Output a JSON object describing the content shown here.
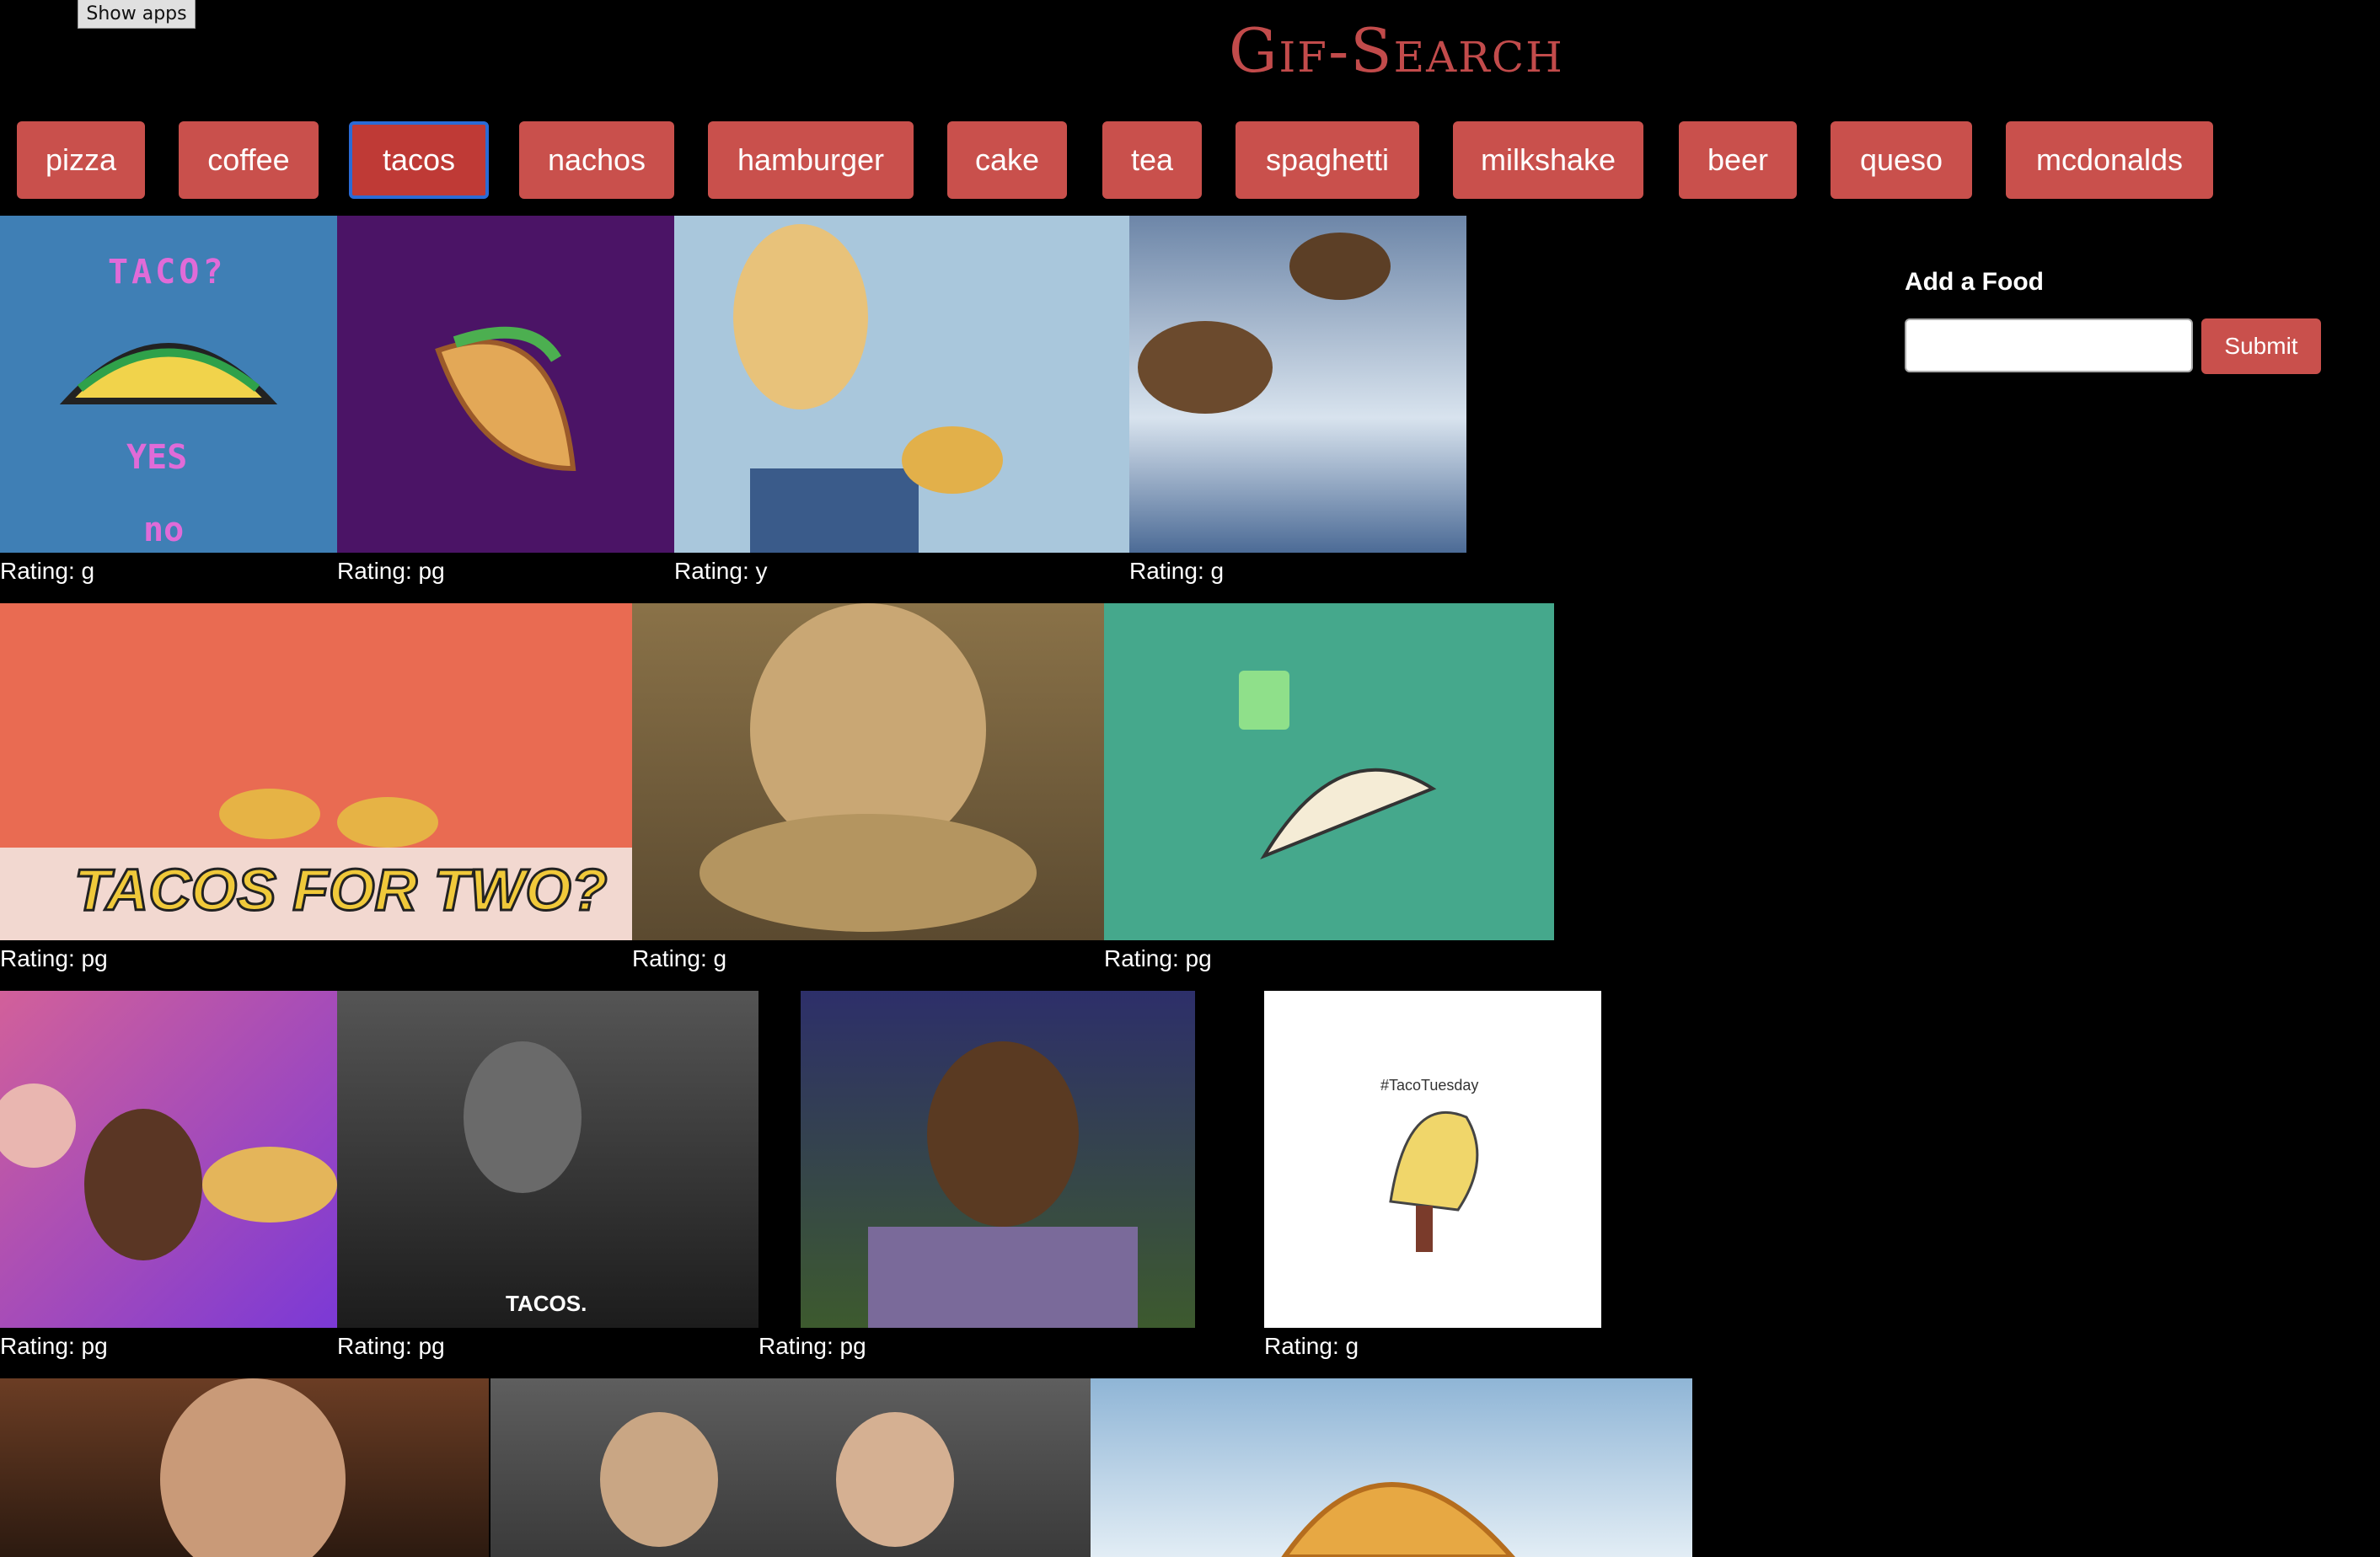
{
  "header": {
    "show_apps_label": "Show apps",
    "title": "Gif-Search"
  },
  "topics": [
    {
      "label": "pizza"
    },
    {
      "label": "coffee"
    },
    {
      "label": "tacos",
      "active": true
    },
    {
      "label": "nachos"
    },
    {
      "label": "hamburger"
    },
    {
      "label": "cake"
    },
    {
      "label": "tea"
    },
    {
      "label": "spaghetti"
    },
    {
      "label": "milkshake"
    },
    {
      "label": "beer"
    },
    {
      "label": "queso"
    },
    {
      "label": "mcdonalds"
    }
  ],
  "gifs": [
    {
      "rating": "Rating: g",
      "caption_top": "TACO?",
      "caption_mid": "YES",
      "caption_bottom": "no"
    },
    {
      "rating": "Rating: pg"
    },
    {
      "rating": "Rating: y"
    },
    {
      "rating": "Rating: g"
    },
    {
      "rating": "Rating: pg",
      "caption": "TACOS FOR TWO?"
    },
    {
      "rating": "Rating: g"
    },
    {
      "rating": "Rating: pg"
    },
    {
      "rating": "Rating: pg"
    },
    {
      "rating": "Rating: pg",
      "caption": "TACOS."
    },
    {
      "rating": "Rating: pg"
    },
    {
      "rating": "Rating: g",
      "caption": "#TacoTuesday"
    },
    {
      "rating": ""
    },
    {
      "rating": ""
    },
    {
      "rating": ""
    }
  ],
  "add_food": {
    "heading": "Add a Food",
    "input_value": "",
    "submit_label": "Submit"
  },
  "colors": {
    "accent": "#c9504c",
    "title": "#c24b4b",
    "background": "#000000"
  }
}
